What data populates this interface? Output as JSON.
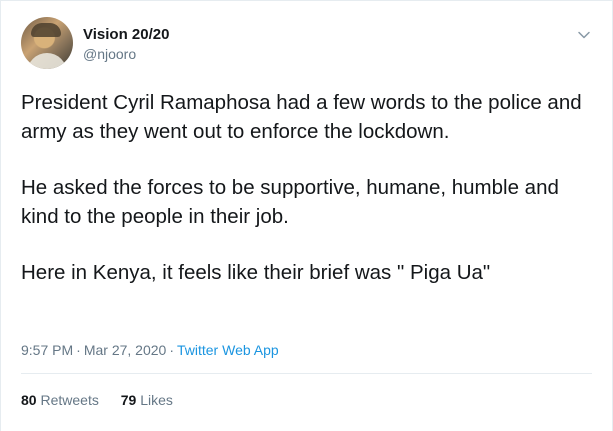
{
  "user": {
    "display_name": "Vision 20/20",
    "handle": "@njooro"
  },
  "tweet": {
    "paragraphs": [
      "President Cyril Ramaphosa had a few words to the police and army as they went out to enforce the lockdown.",
      "He asked the forces to be supportive, humane, humble and kind to the people in their job.",
      "Here in Kenya, it feels like their brief was \" Piga Ua\""
    ],
    "time": "9:57 PM",
    "date": "Mar 27, 2020",
    "separator": "·",
    "source": "Twitter Web App"
  },
  "stats": {
    "retweets_count": "80",
    "retweets_label": "Retweets",
    "likes_count": "79",
    "likes_label": "Likes"
  },
  "icons": {
    "caret": "chevron-down-icon"
  },
  "colors": {
    "text": "#14171a",
    "secondary": "#657786",
    "link": "#1b95e0",
    "border": "#e6ecf0"
  }
}
